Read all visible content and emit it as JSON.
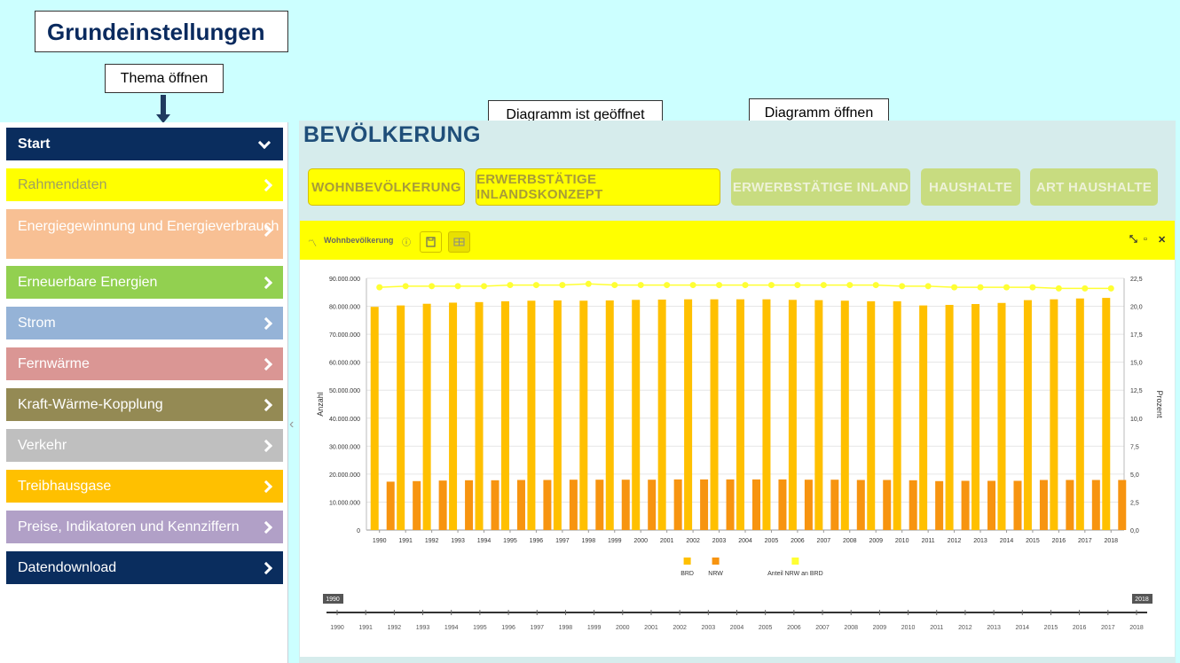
{
  "callouts": {
    "title": "Grundeinstellungen",
    "thema": "Thema öffnen",
    "diagramm_offen": "Diagramm ist geöffnet",
    "diagramm_oeffnen": "Diagramm öffnen"
  },
  "sidebar": {
    "items": [
      {
        "label": "Start",
        "color": "#0a2d5e",
        "bold": true,
        "expanded": true
      },
      {
        "label": "Rahmendaten",
        "color": "#ffff00",
        "textColor": "#a0a060"
      },
      {
        "label": "Energiegewinnung und Energieverbrauch",
        "color": "#f8c094"
      },
      {
        "label": "Erneuerbare Energien",
        "color": "#92d050"
      },
      {
        "label": "Strom",
        "color": "#95b3d7"
      },
      {
        "label": "Fernwärme",
        "color": "#da9694"
      },
      {
        "label": "Kraft-Wärme-Kopplung",
        "color": "#948a54"
      },
      {
        "label": "Verkehr",
        "color": "#bfbfbf"
      },
      {
        "label": "Treibhausgase",
        "color": "#ffc000"
      },
      {
        "label": "Preise, Indikatoren und Kennziffern",
        "color": "#b1a0c7"
      },
      {
        "label": "Datendownload",
        "color": "#0a2d5e"
      }
    ]
  },
  "main": {
    "title": "BEVÖLKERUNG",
    "tabs": [
      {
        "label": "WOHNBEVÖLKERUNG",
        "active": true
      },
      {
        "label": "ERWERBSTÄTIGE INLANDSKONZEPT",
        "active": true
      },
      {
        "label": "ERWERBSTÄTIGE INLAND",
        "active": false
      },
      {
        "label": "HAUSHALTE",
        "active": false
      },
      {
        "label": "ART HAUSHALTE",
        "active": false
      }
    ]
  },
  "chart_panel": {
    "title": "Wohnbevölkerung",
    "icons": [
      "line-chart-icon",
      "info-icon",
      "save-icon",
      "table-icon",
      "collapse-icon",
      "maximize-icon",
      "close-icon"
    ]
  },
  "chart_data": {
    "type": "bar",
    "categories": [
      "1990",
      "1991",
      "1992",
      "1993",
      "1994",
      "1995",
      "1996",
      "1997",
      "1998",
      "1999",
      "2000",
      "2001",
      "2002",
      "2003",
      "2004",
      "2005",
      "2006",
      "2007",
      "2008",
      "2009",
      "2010",
      "2011",
      "2012",
      "2013",
      "2014",
      "2015",
      "2016",
      "2017",
      "2018"
    ],
    "series": [
      {
        "name": "BRD",
        "kind": "bar",
        "axis": "left",
        "color": "#ffc000",
        "values": [
          79800000,
          80300000,
          80900000,
          81300000,
          81500000,
          81800000,
          82000000,
          82100000,
          82000000,
          82100000,
          82300000,
          82400000,
          82500000,
          82500000,
          82500000,
          82500000,
          82300000,
          82200000,
          82000000,
          81800000,
          81800000,
          80300000,
          80500000,
          80800000,
          81200000,
          82200000,
          82500000,
          82800000,
          83000000
        ]
      },
      {
        "name": "NRW",
        "kind": "bar",
        "axis": "left",
        "color": "#f79410",
        "values": [
          17300000,
          17500000,
          17700000,
          17800000,
          17800000,
          17900000,
          17900000,
          18000000,
          18000000,
          18000000,
          18000000,
          18100000,
          18100000,
          18100000,
          18100000,
          18100000,
          18000000,
          18000000,
          17900000,
          17900000,
          17800000,
          17500000,
          17600000,
          17600000,
          17600000,
          17900000,
          17900000,
          17900000,
          17900000
        ]
      },
      {
        "name": "Anteil NRW an BRD",
        "kind": "line",
        "axis": "right",
        "color": "#ffff33",
        "values": [
          21.7,
          21.8,
          21.8,
          21.8,
          21.8,
          21.9,
          21.9,
          21.9,
          22.0,
          21.9,
          21.9,
          21.9,
          21.9,
          21.9,
          21.9,
          21.9,
          21.9,
          21.9,
          21.9,
          21.9,
          21.8,
          21.8,
          21.7,
          21.7,
          21.7,
          21.7,
          21.6,
          21.6,
          21.6
        ]
      }
    ],
    "ylabel": "Anzahl",
    "y2label": "Prozent",
    "ylim": [
      0,
      90000000
    ],
    "y2lim": [
      0,
      22.5
    ],
    "yticks": [
      "0",
      "10.000.000",
      "20.000.000",
      "30.000.000",
      "40.000.000",
      "50.000.000",
      "60.000.000",
      "70.000.000",
      "80.000.000",
      "90.000.000"
    ],
    "y2ticks": [
      "0,0",
      "2,5",
      "5,0",
      "7,5",
      "10,0",
      "12,5",
      "15,0",
      "17,5",
      "20,0",
      "22,5"
    ],
    "legend_position": "bottom",
    "range_slider": {
      "start": "1990",
      "end": "2018"
    }
  }
}
